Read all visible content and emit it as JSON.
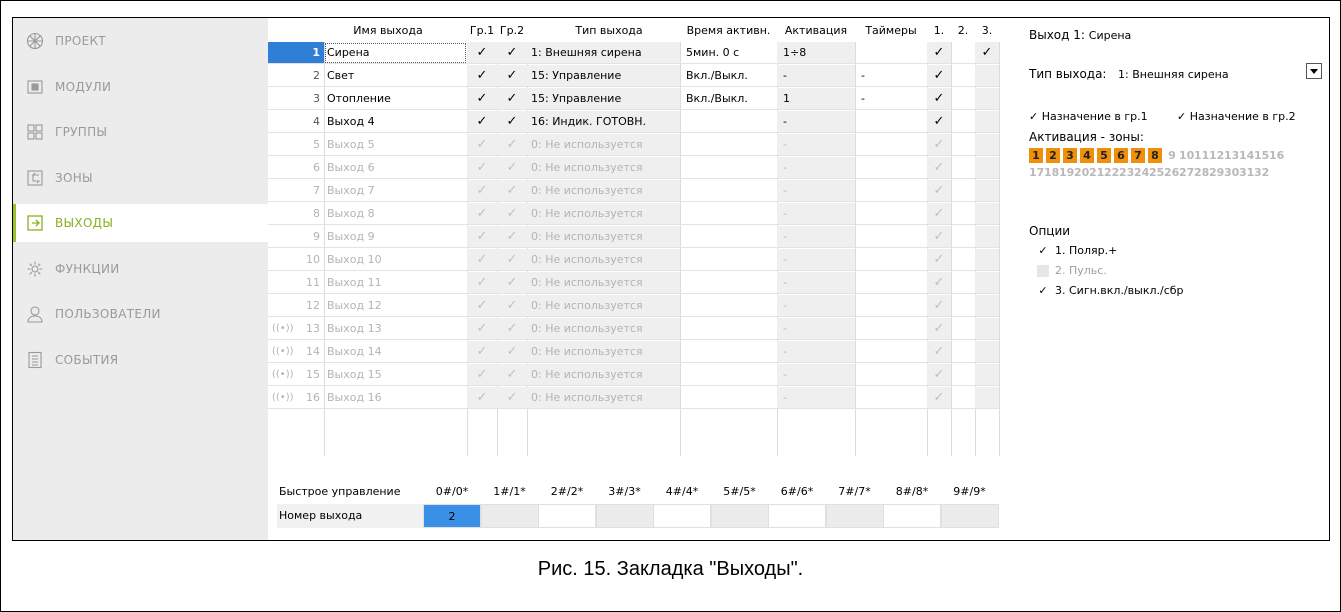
{
  "sidebar": {
    "items": [
      {
        "label": "ПРОЕКТ",
        "icon": "project-icon"
      },
      {
        "label": "МОДУЛИ",
        "icon": "modules-icon"
      },
      {
        "label": "ГРУППЫ",
        "icon": "groups-icon"
      },
      {
        "label": "ЗОНЫ",
        "icon": "zones-icon"
      },
      {
        "label": "ВЫХОДЫ",
        "icon": "outputs-icon"
      },
      {
        "label": "ФУНКЦИИ",
        "icon": "functions-icon"
      },
      {
        "label": "ПОЛЬЗОВАТЕЛИ",
        "icon": "users-icon"
      },
      {
        "label": "СОБЫТИЯ",
        "icon": "events-icon"
      }
    ],
    "active": "ВЫХОДЫ"
  },
  "table": {
    "headers": {
      "name": "Имя выхода",
      "g1": "Гр.1",
      "g2": "Гр.2",
      "type": "Тип выхода",
      "time": "Время активн.",
      "act": "Активация",
      "timers": "Таймеры",
      "c1": "1.",
      "c2": "2.",
      "c3": "3."
    },
    "check": "✓",
    "rows": [
      {
        "num": "1",
        "name": "Сирена",
        "g1": true,
        "g2": true,
        "type": "1: Внешняя сирена",
        "time": "5мин. 0 с",
        "act": "1÷8",
        "timers": "",
        "c1": true,
        "c2": false,
        "c3": true,
        "enabled": true,
        "wireless": false
      },
      {
        "num": "2",
        "name": "Свет",
        "g1": true,
        "g2": true,
        "type": "15: Управление",
        "time": "Вкл./Выкл.",
        "act": "-",
        "timers": "-",
        "c1": true,
        "c2": false,
        "c3": false,
        "enabled": true,
        "wireless": false
      },
      {
        "num": "3",
        "name": "Отопление",
        "g1": true,
        "g2": true,
        "type": "15: Управление",
        "time": "Вкл./Выкл.",
        "act": "1",
        "timers": "-",
        "c1": true,
        "c2": false,
        "c3": false,
        "enabled": true,
        "wireless": false
      },
      {
        "num": "4",
        "name": "Выход 4",
        "g1": true,
        "g2": true,
        "type": "16: Индик. ГОТОВН.",
        "time": "",
        "act": "-",
        "timers": "",
        "c1": true,
        "c2": false,
        "c3": false,
        "enabled": true,
        "wireless": false
      },
      {
        "num": "5",
        "name": "Выход 5",
        "g1": true,
        "g2": true,
        "type": "0: Не используется",
        "time": "",
        "act": "-",
        "timers": "",
        "c1": true,
        "c2": false,
        "c3": false,
        "enabled": false,
        "wireless": false
      },
      {
        "num": "6",
        "name": "Выход 6",
        "g1": true,
        "g2": true,
        "type": "0: Не используется",
        "time": "",
        "act": "-",
        "timers": "",
        "c1": true,
        "c2": false,
        "c3": false,
        "enabled": false,
        "wireless": false
      },
      {
        "num": "7",
        "name": "Выход 7",
        "g1": true,
        "g2": true,
        "type": "0: Не используется",
        "time": "",
        "act": "-",
        "timers": "",
        "c1": true,
        "c2": false,
        "c3": false,
        "enabled": false,
        "wireless": false
      },
      {
        "num": "8",
        "name": "Выход 8",
        "g1": true,
        "g2": true,
        "type": "0: Не используется",
        "time": "",
        "act": "-",
        "timers": "",
        "c1": true,
        "c2": false,
        "c3": false,
        "enabled": false,
        "wireless": false
      },
      {
        "num": "9",
        "name": "Выход 9",
        "g1": true,
        "g2": true,
        "type": "0: Не используется",
        "time": "",
        "act": "-",
        "timers": "",
        "c1": true,
        "c2": false,
        "c3": false,
        "enabled": false,
        "wireless": false
      },
      {
        "num": "10",
        "name": "Выход 10",
        "g1": true,
        "g2": true,
        "type": "0: Не используется",
        "time": "",
        "act": "-",
        "timers": "",
        "c1": true,
        "c2": false,
        "c3": false,
        "enabled": false,
        "wireless": false
      },
      {
        "num": "11",
        "name": "Выход 11",
        "g1": true,
        "g2": true,
        "type": "0: Не используется",
        "time": "",
        "act": "-",
        "timers": "",
        "c1": true,
        "c2": false,
        "c3": false,
        "enabled": false,
        "wireless": false
      },
      {
        "num": "12",
        "name": "Выход 12",
        "g1": true,
        "g2": true,
        "type": "0: Не используется",
        "time": "",
        "act": "-",
        "timers": "",
        "c1": true,
        "c2": false,
        "c3": false,
        "enabled": false,
        "wireless": false
      },
      {
        "num": "13",
        "name": "Выход 13",
        "g1": true,
        "g2": true,
        "type": "0: Не используется",
        "time": "",
        "act": "-",
        "timers": "",
        "c1": true,
        "c2": false,
        "c3": false,
        "enabled": false,
        "wireless": true
      },
      {
        "num": "14",
        "name": "Выход 14",
        "g1": true,
        "g2": true,
        "type": "0: Не используется",
        "time": "",
        "act": "-",
        "timers": "",
        "c1": true,
        "c2": false,
        "c3": false,
        "enabled": false,
        "wireless": true
      },
      {
        "num": "15",
        "name": "Выход 15",
        "g1": true,
        "g2": true,
        "type": "0: Не используется",
        "time": "",
        "act": "-",
        "timers": "",
        "c1": true,
        "c2": false,
        "c3": false,
        "enabled": false,
        "wireless": true
      },
      {
        "num": "16",
        "name": "Выход 16",
        "g1": true,
        "g2": true,
        "type": "0: Не используется",
        "time": "",
        "act": "-",
        "timers": "",
        "c1": true,
        "c2": false,
        "c3": false,
        "enabled": false,
        "wireless": true
      }
    ]
  },
  "quick": {
    "row1_label": "Быстрое управление",
    "row2_label": "Номер выхода",
    "codes": [
      "0#/0*",
      "1#/1*",
      "2#/2*",
      "3#/3*",
      "4#/4*",
      "5#/5*",
      "6#/6*",
      "7#/7*",
      "8#/8*",
      "9#/9*"
    ],
    "outputs": [
      "2",
      "",
      "",
      "",
      "",
      "",
      "",
      "",
      "",
      ""
    ]
  },
  "details": {
    "title_prefix": "Выход 1:",
    "title_name": "Сирена",
    "type_label": "Тип выхода:",
    "type_value": "1: Внешняя сирена",
    "assign_g1": "Назначение в гр.1",
    "assign_g2": "Назначение в гр.2",
    "activation_label": "Активация - зоны:",
    "zones_row1": [
      "1",
      "2",
      "3",
      "4",
      "5",
      "6",
      "7",
      "8",
      "9",
      "10",
      "11",
      "12",
      "13",
      "14",
      "15",
      "16"
    ],
    "zones_row2": [
      "17",
      "18",
      "19",
      "20",
      "21",
      "22",
      "23",
      "24",
      "25",
      "26",
      "27",
      "28",
      "29",
      "30",
      "31",
      "32"
    ],
    "zones_active": [
      "1",
      "2",
      "3",
      "4",
      "5",
      "6",
      "7",
      "8"
    ],
    "options_label": "Опции",
    "options": [
      {
        "label": "1. Поляр.+",
        "checked": true,
        "enabled": true
      },
      {
        "label": "2. Пульс.",
        "checked": false,
        "enabled": false
      },
      {
        "label": "3. Сигн.вкл./выкл./сбр",
        "checked": true,
        "enabled": true
      }
    ]
  },
  "caption": "Рис. 15. Закладка \"Выходы\".",
  "colors": {
    "accent": "#9cc02a",
    "selected": "#2f7fd6",
    "zone_active": "#f0900a"
  }
}
